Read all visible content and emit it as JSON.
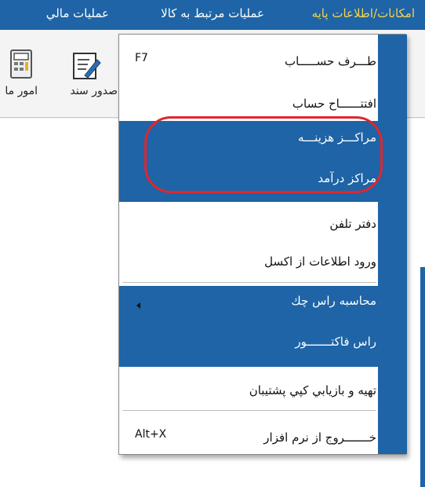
{
  "menubar": {
    "items": [
      {
        "label": "امکانات/اطلاعات پایه",
        "active": true
      },
      {
        "label": "عملیات مرتبط به کالا",
        "active": false
      },
      {
        "label": "عملیات مالي",
        "active": false
      }
    ]
  },
  "toolbar": {
    "buttons": [
      {
        "label": "صدور سند",
        "icon": "edit-document-icon"
      },
      {
        "label": "امور ما",
        "icon": "calculator-icon"
      }
    ]
  },
  "dropdown": {
    "items": [
      {
        "label": "طـــرف حســـــاب",
        "shortcut": "F7"
      },
      {
        "label": "افتتــــــاح حساب",
        "shortcut": ""
      },
      {
        "label": "مراکـــز هزینـــه",
        "shortcut": ""
      },
      {
        "label": "مراکز درآمد",
        "shortcut": ""
      },
      {
        "label": "دفتر تلفن",
        "shortcut": ""
      },
      {
        "label": "ورود اطلاعات از اکسل",
        "shortcut": ""
      },
      {
        "label": "محاسبه راس چك",
        "shortcut": "",
        "submenu": true
      },
      {
        "label": "راس فاکتـــــــور",
        "shortcut": ""
      },
      {
        "label": "تهيه و بازيابي کپي پشتيبان",
        "shortcut": ""
      },
      {
        "label": "خـــــــروج از نرم افزار",
        "shortcut": "Alt+X"
      }
    ]
  },
  "colors": {
    "menubar": "#1e64a6",
    "active_menu_text": "#f6d34a",
    "highlight_ring": "#e0262e"
  }
}
